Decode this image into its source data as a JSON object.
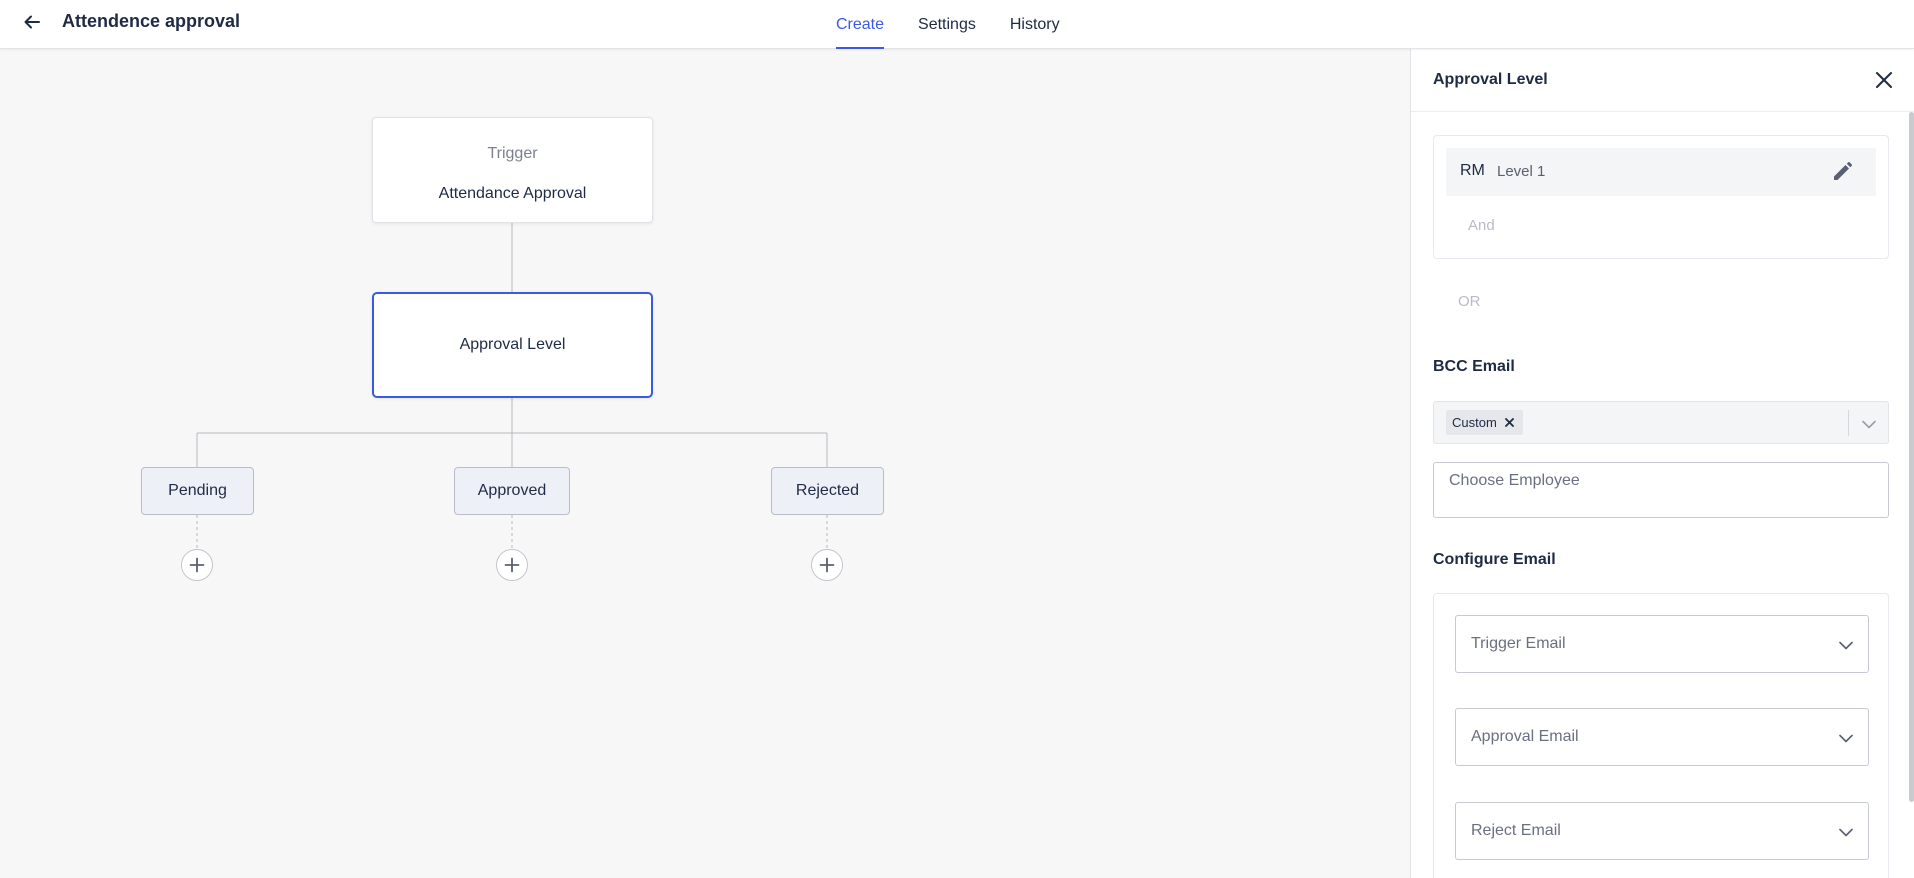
{
  "header": {
    "back_icon": "arrow-left-icon",
    "title": "Attendence approval",
    "tabs": [
      {
        "label": "Create",
        "active": true
      },
      {
        "label": "Settings",
        "active": false
      },
      {
        "label": "History",
        "active": false
      }
    ]
  },
  "flow": {
    "trigger": {
      "type": "Trigger",
      "name": "Attendance Approval"
    },
    "approval_node": {
      "label": "Approval Level"
    },
    "statuses": [
      {
        "label": "Pending"
      },
      {
        "label": "Approved"
      },
      {
        "label": "Rejected"
      }
    ],
    "add_icon": "plus-circle-icon"
  },
  "panel": {
    "title": "Approval Level",
    "close_icon": "close-icon",
    "level": {
      "role": "RM",
      "name": "Level 1",
      "edit_icon": "pencil-icon"
    },
    "and_label": "And",
    "or_label": "OR",
    "bcc": {
      "label": "BCC Email",
      "chip": "Custom",
      "employee_placeholder": "Choose Employee"
    },
    "configure_email": {
      "label": "Configure Email",
      "options": [
        {
          "label": "Trigger Email"
        },
        {
          "label": "Approval Email"
        },
        {
          "label": "Reject Email"
        }
      ]
    }
  },
  "colors": {
    "accent": "#3a5be0",
    "text": "#1f2a44",
    "canvas_bg": "#f7f7f7",
    "status_bg": "#eef0f7"
  }
}
